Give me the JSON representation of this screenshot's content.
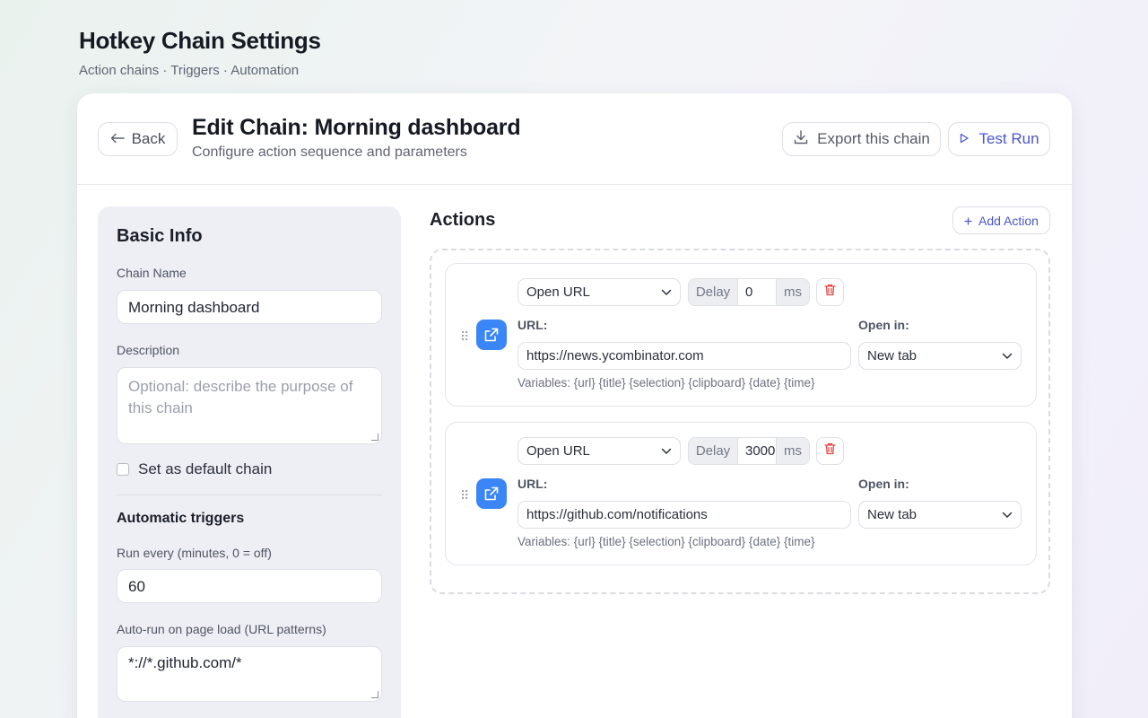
{
  "page": {
    "title": "Hotkey Chain Settings",
    "subtitle": "Action chains · Triggers · Automation"
  },
  "header": {
    "back_label": "Back",
    "edit_title": "Edit Chain: Morning dashboard",
    "edit_subtitle": "Configure action sequence and parameters",
    "export_label": "Export this chain",
    "test_label": "Test Run"
  },
  "basic_info": {
    "title": "Basic Info",
    "chain_name_label": "Chain Name",
    "chain_name_value": "Morning dashboard",
    "description_label": "Description",
    "description_placeholder": "Optional: describe the purpose of this chain",
    "default_label": "Set as default chain",
    "default_checked": false,
    "triggers_title": "Automatic triggers",
    "run_every_label": "Run every (minutes, 0 = off)",
    "run_every_value": "60",
    "autorun_label": "Auto-run on page load (URL patterns)",
    "autorun_value": "*://*.github.com/*"
  },
  "actions": {
    "title": "Actions",
    "add_label": "Add Action",
    "items": [
      {
        "type": "Open URL",
        "delay_label": "Delay",
        "delay_value": "0",
        "delay_unit": "ms",
        "url_label": "URL:",
        "url_value": "https://news.ycombinator.com",
        "open_in_label": "Open in:",
        "open_in_value": "New tab",
        "variables": "Variables: {url} {title} {selection} {clipboard} {date} {time}"
      },
      {
        "type": "Open URL",
        "delay_label": "Delay",
        "delay_value": "3000",
        "delay_unit": "ms",
        "url_label": "URL:",
        "url_value": "https://github.com/notifications",
        "open_in_label": "Open in:",
        "open_in_value": "New tab",
        "variables": "Variables: {url} {title} {selection} {clipboard} {date} {time}"
      }
    ]
  },
  "colors": {
    "accent": "#4a55c9",
    "action_icon": "#3a86f6",
    "delete": "#e04848"
  }
}
